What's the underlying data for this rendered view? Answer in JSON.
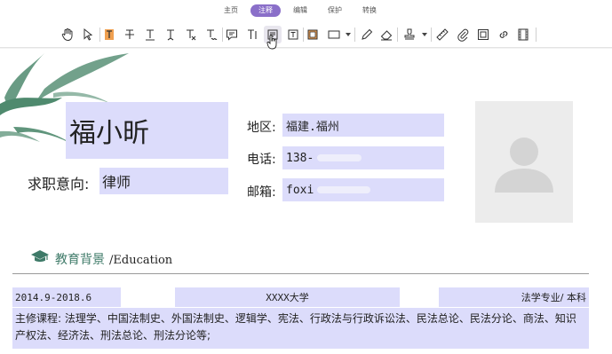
{
  "menu": {
    "tabs": [
      {
        "label": "主页",
        "active": false
      },
      {
        "label": "注释",
        "active": true
      },
      {
        "label": "编辑",
        "active": false
      },
      {
        "label": "保护",
        "active": false
      },
      {
        "label": "转换",
        "active": false
      }
    ]
  },
  "toolbar": {
    "tools": [
      "hand-icon",
      "select-arrow-icon",
      "highlight-text-icon",
      "strikethrough-text-icon",
      "underline-text-icon",
      "insert-text-icon",
      "replace-text-icon",
      "squiggly-text-icon",
      "note-comment-icon",
      "typewriter-icon",
      "text-box-icon",
      "callout-icon",
      "area-highlight-icon",
      "rectangle-icon",
      "pencil-icon",
      "eraser-icon",
      "stamp-icon",
      "measure-ruler-icon",
      "attachment-icon",
      "image-annotation-icon",
      "link-icon",
      "video-icon"
    ]
  },
  "resume": {
    "name": "福小昕",
    "job_label": "求职意向:",
    "job_value": "律师",
    "location_label": "地区:",
    "location_value": "福建.福州",
    "phone_label": "电话:",
    "phone_value": "138-",
    "email_label": "邮箱:",
    "email_value": "foxi",
    "section_title_cn": "教育背景",
    "section_title_en": "/Education",
    "edu_date": "2014.9-2018.6",
    "edu_school": "XXXX大学",
    "edu_major": "法学专业/ 本科",
    "courses": "主修课程:  法理学、中国法制史、外国法制史、逻辑学、宪法、行政法与行政诉讼法、民法总论、民法分论、商法、知识产权法、经济法、刑法总论、刑法分论等;"
  },
  "colors": {
    "accent": "#8a6fc9",
    "field_bg": "#dcdcfb",
    "section_green": "#3e7a68",
    "leaf_green": "#4f8a6e"
  }
}
